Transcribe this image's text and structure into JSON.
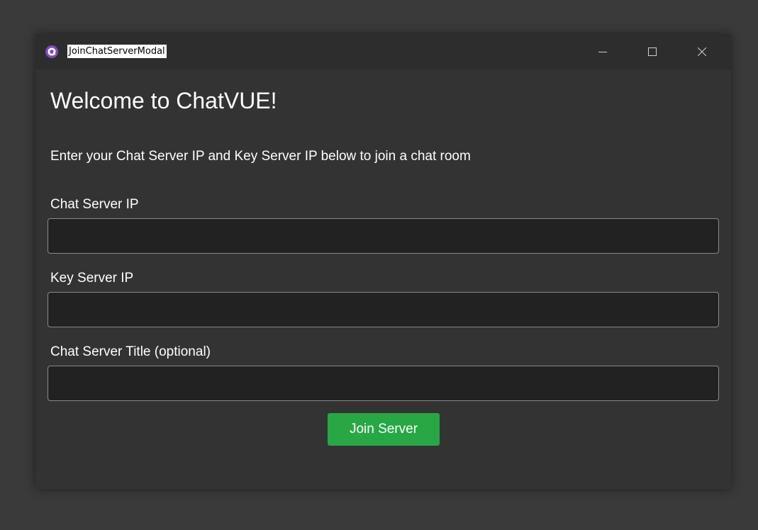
{
  "window": {
    "title": "JoinChatServerModal",
    "controls": {
      "minimize": "minimize-icon",
      "maximize": "maximize-icon",
      "close": "close-icon"
    }
  },
  "modal": {
    "heading": "Welcome to ChatVUE!",
    "subtitle": "Enter your Chat Server IP and Key Server IP below to join a chat room",
    "fields": [
      {
        "label": "Chat Server IP",
        "value": "",
        "placeholder": ""
      },
      {
        "label": "Key Server IP",
        "value": "",
        "placeholder": ""
      },
      {
        "label": "Chat Server Title (optional)",
        "value": "",
        "placeholder": ""
      }
    ],
    "join_button_label": "Join Server"
  },
  "colors": {
    "background": "#3a3a3a",
    "window": "#333333",
    "titlebar": "#2d2d2d",
    "input_bg": "#222222",
    "accent": "#28a745",
    "app_icon": "#7b4dbb"
  }
}
